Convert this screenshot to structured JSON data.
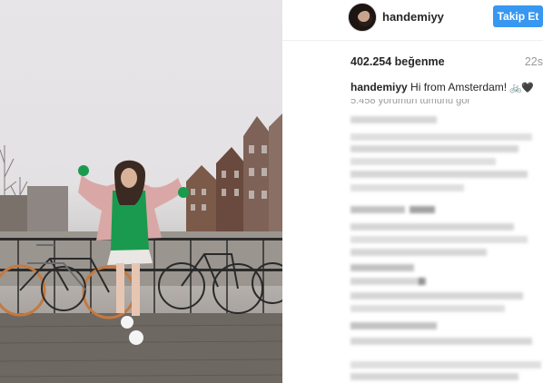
{
  "post": {
    "username": "handemiyy",
    "follow_label": "Takip Et",
    "likes": "402.254 beğenme",
    "time_ago": "22s",
    "caption_user": "handemiyy",
    "caption_text": "Hi from Amsterdam!",
    "caption_emoji": "🚲🖤",
    "view_comments": "5.458 yorumun tümünü gör"
  },
  "colors": {
    "follow_button": "#3897f0",
    "muted_text": "#999999",
    "jacket": "#d9a8a6",
    "sweater": "#1a9a4f"
  }
}
